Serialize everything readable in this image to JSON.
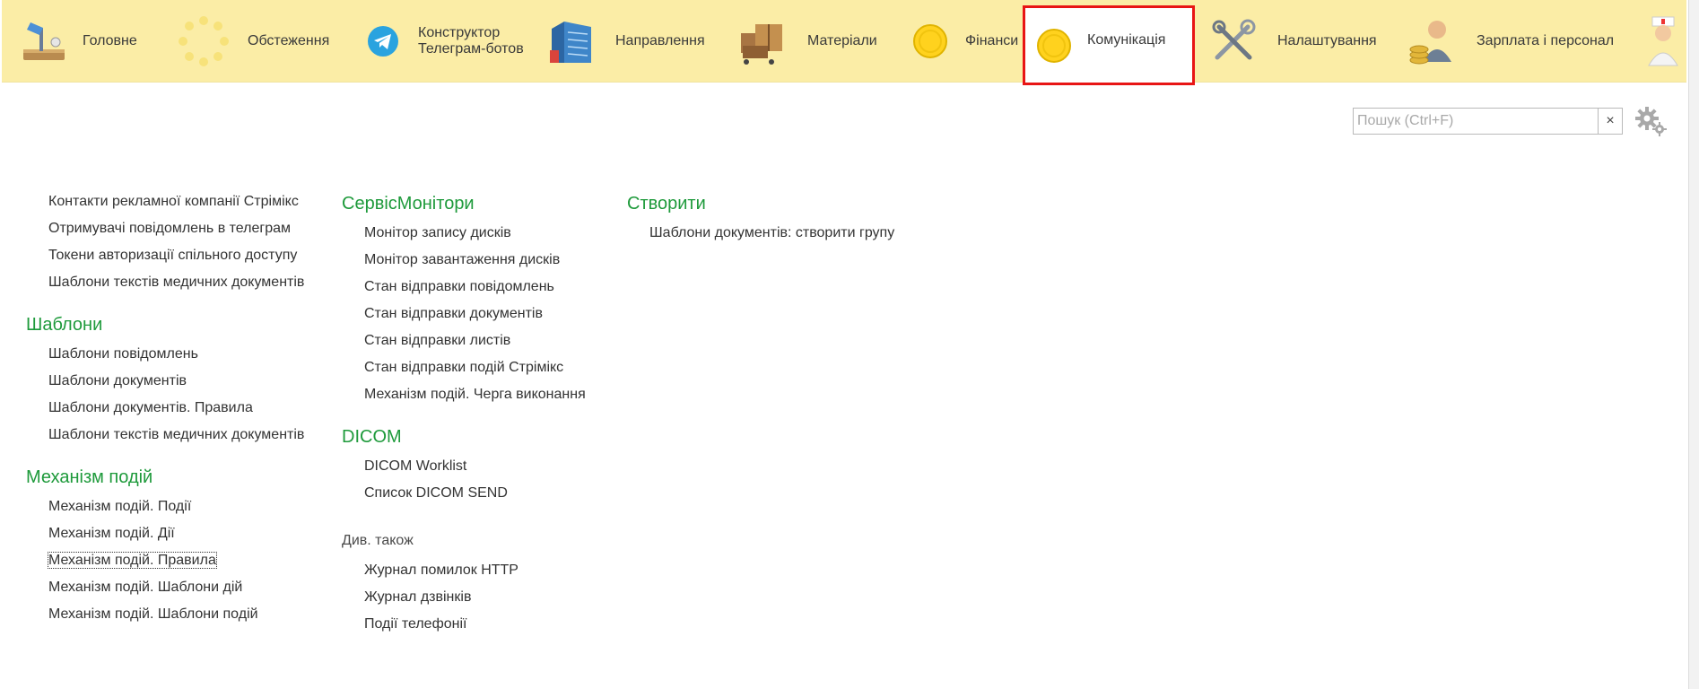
{
  "nav": {
    "items": [
      {
        "label": "Головне",
        "icon": "desk-lamp-icon"
      },
      {
        "label": "Обстеження",
        "icon": "loading-spinner-icon"
      },
      {
        "label": "Конструктор Телеграм-ботов",
        "icon": "telegram-icon"
      },
      {
        "label": "Направлення",
        "icon": "building-icon"
      },
      {
        "label": "Матеріали",
        "icon": "boxes-cart-icon"
      },
      {
        "label": "Фінанси",
        "icon": "yellow-circle-icon"
      },
      {
        "label": "Комунікація",
        "icon": "yellow-circle-icon",
        "active": true
      },
      {
        "label": "Налаштування",
        "icon": "tools-icon"
      },
      {
        "label": "Зарплата і персонал",
        "icon": "worker-coins-icon"
      },
      {
        "label": "",
        "icon": "nurse-icon"
      }
    ]
  },
  "search": {
    "placeholder": "Пошук (Ctrl+F)",
    "clear": "×"
  },
  "col1": {
    "top_links": [
      "Контакти рекламної компанії Стрімікс",
      "Отримувачі повідомлень в телеграм",
      "Токени авторизації спільного доступу",
      "Шаблони текстів медичних документів"
    ],
    "templates_title": "Шаблони",
    "templates_links": [
      "Шаблони повідомлень",
      "Шаблони документів",
      "Шаблони документів. Правила",
      "Шаблони текстів медичних документів"
    ],
    "events_title": "Механізм подій",
    "events_links": [
      "Механізм подій. Події",
      "Механізм подій. Дії",
      "Механізм подій. Правила",
      "Механізм подій. Шаблони дій",
      "Механізм подій. Шаблони подій"
    ]
  },
  "col2": {
    "service_title": "СервісМонітори",
    "service_links": [
      "Монітор запису дисків",
      "Монітор завантаження дисків",
      "Стан відправки повідомлень",
      "Стан відправки документів",
      "Стан відправки листів",
      "Стан відправки подій Стрімікс",
      "Механізм подій. Черга виконання"
    ],
    "dicom_title": "DICOM",
    "dicom_links": [
      "DICOM Worklist",
      "Список DICOM SEND"
    ],
    "see_also_title": "Див. також",
    "see_also_links": [
      "Журнал помилок HTTP",
      "Журнал дзвінків",
      "Події телефонії"
    ]
  },
  "col3": {
    "create_title": "Створити",
    "create_links": [
      "Шаблони документів: створити групу"
    ]
  },
  "colors": {
    "accent_green": "#1e9a3b",
    "topbar": "#fbeda6",
    "active_outline": "#e81515"
  }
}
